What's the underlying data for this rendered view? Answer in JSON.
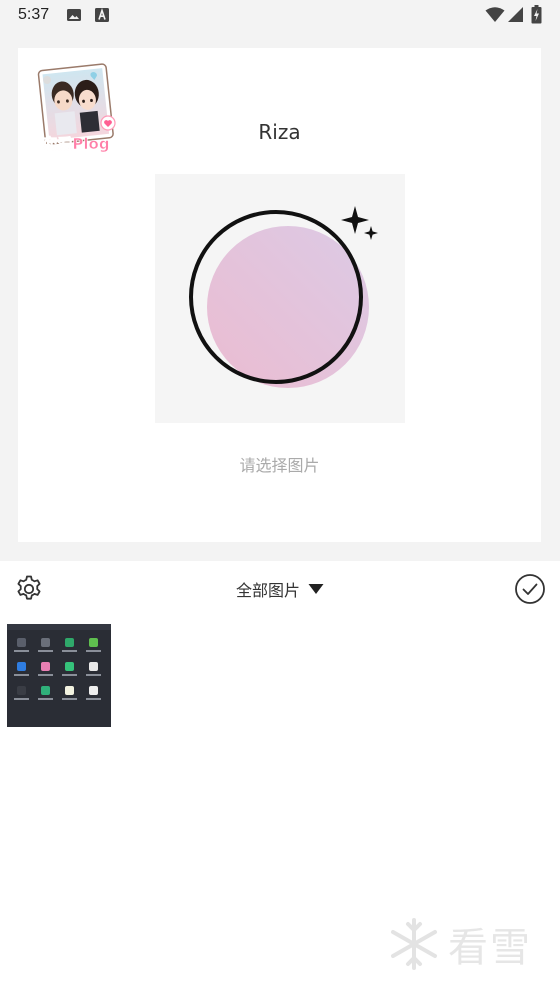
{
  "status_bar": {
    "time": "5:37",
    "left_icons": [
      "image-notification-icon",
      "a-notification-icon"
    ],
    "right_icons": [
      "wifi-icon",
      "signal-icon",
      "battery-charging-icon"
    ]
  },
  "card": {
    "sticker_text": "恋爱Plog",
    "username": "Riza",
    "choose_image_text": "请选择图片"
  },
  "toolbar": {
    "settings_icon": "gear-icon",
    "album_label": "全部图片",
    "dropdown_icon": "triangle-down-icon",
    "confirm_icon": "check-circle-icon"
  },
  "gallery": {
    "thumbnails": [
      {
        "label": "screenshot-thumbnail"
      }
    ]
  },
  "watermark": {
    "text": "看雪"
  },
  "colors": {
    "background": "#f3f3f3",
    "card": "#ffffff",
    "gradient_start": "#e8bcd4",
    "gradient_end": "#dcc9e6",
    "text_muted": "#aaaaaa",
    "watermark": "#e6e6e6"
  }
}
